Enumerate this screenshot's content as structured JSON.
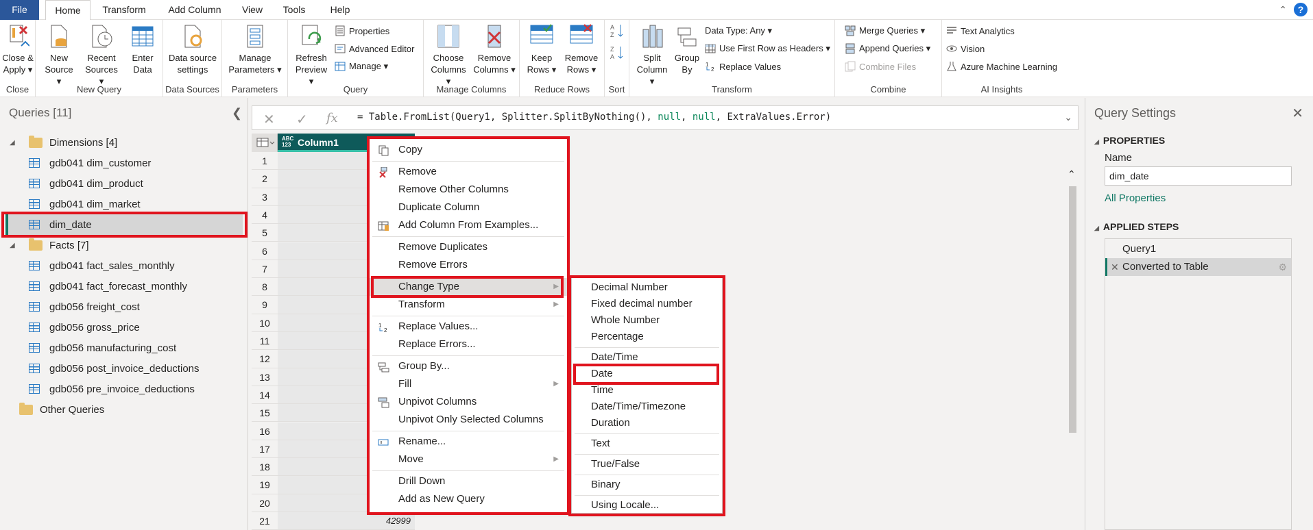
{
  "tabs": {
    "file": "File",
    "home": "Home",
    "transform": "Transform",
    "add_column": "Add Column",
    "view": "View",
    "tools": "Tools",
    "help": "Help"
  },
  "help_icon": "?",
  "ribbon": {
    "close": {
      "label1": "Close &",
      "label2": "Apply ▾",
      "group": "Close"
    },
    "new_query": {
      "new_source1": "New",
      "new_source2": "Source ▾",
      "recent1": "Recent",
      "recent2": "Sources ▾",
      "enter1": "Enter",
      "enter2": "Data",
      "group": "New Query"
    },
    "data_sources": {
      "label1": "Data source",
      "label2": "settings",
      "group": "Data Sources"
    },
    "parameters": {
      "label1": "Manage",
      "label2": "Parameters ▾",
      "group": "Parameters"
    },
    "query": {
      "refresh1": "Refresh",
      "refresh2": "Preview ▾",
      "properties": "Properties",
      "advanced": "Advanced Editor",
      "manage": "Manage ▾",
      "group": "Query"
    },
    "manage_columns": {
      "choose1": "Choose",
      "choose2": "Columns ▾",
      "remove1": "Remove",
      "remove2": "Columns ▾",
      "group": "Manage Columns"
    },
    "reduce_rows": {
      "keep1": "Keep",
      "keep2": "Rows ▾",
      "remove1": "Remove",
      "remove2": "Rows ▾",
      "group": "Reduce Rows"
    },
    "sort": {
      "group": "Sort"
    },
    "transform": {
      "split1": "Split",
      "split2": "Column ▾",
      "group1": "Group",
      "group2": "By",
      "datatype": "Data Type: Any ▾",
      "first_row": "Use First Row as Headers ▾",
      "replace": "Replace Values",
      "group": "Transform"
    },
    "combine": {
      "merge": "Merge Queries ▾",
      "append": "Append Queries ▾",
      "combine_files": "Combine Files",
      "group": "Combine"
    },
    "ai": {
      "text": "Text Analytics",
      "vision": "Vision",
      "aml": "Azure Machine Learning",
      "group": "AI Insights"
    }
  },
  "queries": {
    "title": "Queries [11]",
    "dimensions": "Dimensions [4]",
    "dim_items": [
      "gdb041 dim_customer",
      "gdb041 dim_product",
      "gdb041 dim_market",
      "dim_date"
    ],
    "facts": "Facts [7]",
    "fact_items": [
      "gdb041 fact_sales_monthly",
      "gdb041 fact_forecast_monthly",
      "gdb056 freight_cost",
      "gdb056 gross_price",
      "gdb056 manufacturing_cost",
      "gdb056 post_invoice_deductions",
      "gdb056 pre_invoice_deductions"
    ],
    "other": "Other Queries"
  },
  "formula": {
    "prefix": "= Table.FromList(Query1, Splitter.SplitByNothing(), ",
    "null1": "null",
    "sep": ", ",
    "null2": "null",
    "suffix": ", ExtraValues.Error)",
    "fx": "fx"
  },
  "grid": {
    "type_icon_top": "ABC",
    "type_icon_bottom": "123",
    "column1": "Column1",
    "rows": [
      "1",
      "2",
      "3",
      "4",
      "5",
      "6",
      "7",
      "8",
      "9",
      "10",
      "11",
      "12",
      "13",
      "14",
      "15",
      "16",
      "17",
      "18",
      "19",
      "20",
      "21"
    ],
    "last_value": "42999"
  },
  "context_menu": {
    "copy": "Copy",
    "remove": "Remove",
    "remove_other": "Remove Other Columns",
    "duplicate": "Duplicate Column",
    "add_from_examples": "Add Column From Examples...",
    "remove_duplicates": "Remove Duplicates",
    "remove_errors": "Remove Errors",
    "change_type": "Change Type",
    "transform": "Transform",
    "replace_values": "Replace Values...",
    "replace_errors": "Replace Errors...",
    "group_by": "Group By...",
    "fill": "Fill",
    "unpivot": "Unpivot Columns",
    "unpivot_selected": "Unpivot Only Selected Columns",
    "rename": "Rename...",
    "move": "Move",
    "drill_down": "Drill Down",
    "add_new_query": "Add as New Query"
  },
  "type_menu": {
    "decimal": "Decimal Number",
    "fixed_decimal": "Fixed decimal number",
    "whole": "Whole Number",
    "percentage": "Percentage",
    "datetime": "Date/Time",
    "date": "Date",
    "time": "Time",
    "datetimezone": "Date/Time/Timezone",
    "duration": "Duration",
    "text": "Text",
    "truefalse": "True/False",
    "binary": "Binary",
    "locale": "Using Locale..."
  },
  "settings": {
    "title": "Query Settings",
    "properties": "PROPERTIES",
    "name_label": "Name",
    "name_value": "dim_date",
    "all_props": "All Properties",
    "applied_steps": "APPLIED STEPS",
    "steps": [
      "Query1",
      "Converted to Table"
    ]
  },
  "colors": {
    "accent": "#117865",
    "file_tab": "#2b579a",
    "column_header": "#0e5a5a",
    "highlight_box": "#e0141e"
  }
}
